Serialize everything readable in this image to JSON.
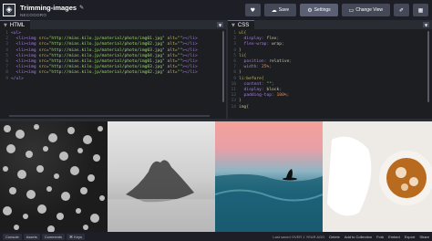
{
  "header": {
    "logo_glyph": "◈",
    "title": "Trimming-images",
    "user": "NECOGORO"
  },
  "toolbar": {
    "heart_icon": "♥",
    "save_label": "Save",
    "save_icon": "☁",
    "settings_label": "Settings",
    "settings_icon": "⚙",
    "change_view_label": "Change View",
    "change_view_icon": "▭",
    "pin_icon": "📌",
    "grid_icon": "▦"
  },
  "html_pane": {
    "label": "HTML",
    "lines": [
      {
        "n": "1",
        "code": [
          [
            "tag",
            "<ul>"
          ]
        ]
      },
      {
        "n": "2",
        "code": [
          [
            "pun",
            "  "
          ],
          [
            "tag",
            "<li>"
          ],
          [
            "tag",
            "<img "
          ],
          [
            "attr",
            "src="
          ],
          [
            "str",
            "\"http://mias.kilo.jp/material/photo/img01.jpg\""
          ],
          [
            "attr",
            " alt="
          ],
          [
            "str",
            "\"\""
          ],
          [
            "tag",
            "></li>"
          ]
        ]
      },
      {
        "n": "3",
        "code": [
          [
            "pun",
            "  "
          ],
          [
            "tag",
            "<li>"
          ],
          [
            "tag",
            "<img "
          ],
          [
            "attr",
            "src="
          ],
          [
            "str",
            "\"http://mias.kilo.jp/material/photo/img02.jpg\""
          ],
          [
            "attr",
            " alt="
          ],
          [
            "str",
            "\"\""
          ],
          [
            "tag",
            "></li>"
          ]
        ]
      },
      {
        "n": "4",
        "code": [
          [
            "pun",
            "  "
          ],
          [
            "tag",
            "<li>"
          ],
          [
            "tag",
            "<img "
          ],
          [
            "attr",
            "src="
          ],
          [
            "str",
            "\"http://mias.kilo.jp/material/photo/img03.jpg\""
          ],
          [
            "attr",
            " alt="
          ],
          [
            "str",
            "\"\""
          ],
          [
            "tag",
            "></li>"
          ]
        ]
      },
      {
        "n": "5",
        "code": [
          [
            "pun",
            "  "
          ],
          [
            "tag",
            "<li>"
          ],
          [
            "tag",
            "<img "
          ],
          [
            "attr",
            "src="
          ],
          [
            "str",
            "\"http://mias.kilo.jp/material/photo/img04.jpg\""
          ],
          [
            "attr",
            " alt="
          ],
          [
            "str",
            "\"\""
          ],
          [
            "tag",
            "></li>"
          ]
        ]
      },
      {
        "n": "6",
        "code": [
          [
            "pun",
            "  "
          ],
          [
            "tag",
            "<li>"
          ],
          [
            "tag",
            "<img "
          ],
          [
            "attr",
            "src="
          ],
          [
            "str",
            "\"http://mias.kilo.jp/material/photo/img01.jpg\""
          ],
          [
            "attr",
            " alt="
          ],
          [
            "str",
            "\"\""
          ],
          [
            "tag",
            "></li>"
          ]
        ]
      },
      {
        "n": "7",
        "code": [
          [
            "pun",
            "  "
          ],
          [
            "tag",
            "<li>"
          ],
          [
            "tag",
            "<img "
          ],
          [
            "attr",
            "src="
          ],
          [
            "str",
            "\"http://mias.kilo.jp/material/photo/img03.jpg\""
          ],
          [
            "attr",
            " alt="
          ],
          [
            "str",
            "\"\""
          ],
          [
            "tag",
            "></li>"
          ]
        ]
      },
      {
        "n": "8",
        "code": [
          [
            "pun",
            "  "
          ],
          [
            "tag",
            "<li>"
          ],
          [
            "tag",
            "<img "
          ],
          [
            "attr",
            "src="
          ],
          [
            "str",
            "\"http://mias.kilo.jp/material/photo/img02.jpg\""
          ],
          [
            "attr",
            " alt="
          ],
          [
            "str",
            "\"\""
          ],
          [
            "tag",
            "></li>"
          ]
        ]
      },
      {
        "n": "9",
        "code": [
          [
            "tag",
            "</ul>"
          ]
        ]
      }
    ]
  },
  "css_pane": {
    "label": "CSS",
    "lines": [
      {
        "n": "1",
        "code": [
          [
            "sel",
            "ul{"
          ]
        ]
      },
      {
        "n": "2",
        "code": [
          [
            "pun",
            "  "
          ],
          [
            "prop",
            "display"
          ],
          [
            "pun",
            ": "
          ],
          [
            "val",
            "flex"
          ],
          [
            "pun",
            ";"
          ]
        ]
      },
      {
        "n": "3",
        "code": [
          [
            "pun",
            "  "
          ],
          [
            "prop",
            "flex-wrap"
          ],
          [
            "pun",
            ": "
          ],
          [
            "val",
            "wrap"
          ],
          [
            "pun",
            ";"
          ]
        ]
      },
      {
        "n": "4",
        "code": [
          [
            "sel",
            "}"
          ]
        ]
      },
      {
        "n": "5",
        "code": [
          [
            "sel",
            "li{"
          ]
        ]
      },
      {
        "n": "6",
        "code": [
          [
            "pun",
            "  "
          ],
          [
            "prop",
            "position"
          ],
          [
            "pun",
            ": "
          ],
          [
            "val",
            "relative"
          ],
          [
            "pun",
            ";"
          ]
        ]
      },
      {
        "n": "7",
        "code": [
          [
            "pun",
            "  "
          ],
          [
            "prop",
            "width"
          ],
          [
            "pun",
            ": "
          ],
          [
            "num",
            "25%"
          ],
          [
            "pun",
            ";"
          ]
        ]
      },
      {
        "n": "8",
        "code": [
          [
            "sel",
            "}"
          ]
        ]
      },
      {
        "n": "9",
        "code": [
          [
            "sel",
            "li:before{"
          ]
        ]
      },
      {
        "n": "10",
        "code": [
          [
            "pun",
            "  "
          ],
          [
            "prop",
            "content"
          ],
          [
            "pun",
            ": "
          ],
          [
            "str",
            "\"\""
          ],
          [
            "pun",
            ";"
          ]
        ]
      },
      {
        "n": "11",
        "code": [
          [
            "pun",
            "  "
          ],
          [
            "prop",
            "display"
          ],
          [
            "pun",
            ": "
          ],
          [
            "val",
            "block"
          ],
          [
            "pun",
            ";"
          ]
        ]
      },
      {
        "n": "12",
        "code": [
          [
            "pun",
            "  "
          ],
          [
            "prop",
            "padding-top"
          ],
          [
            "pun",
            ": "
          ],
          [
            "num",
            "100%"
          ],
          [
            "pun",
            ";"
          ]
        ]
      },
      {
        "n": "13",
        "code": [
          [
            "sel",
            "}"
          ]
        ]
      },
      {
        "n": "14",
        "code": [
          [
            "sel",
            "img{"
          ]
        ]
      }
    ]
  },
  "footer": {
    "console": "Console",
    "assets": "Assets",
    "comments": "Comments",
    "keys": "⌘ Keys",
    "saved": "Last saved OVER 1 YEAR AGO",
    "delete": "Delete",
    "add_collection": "Add to Collection",
    "fork": "Fork",
    "embed": "Embed",
    "export": "Export",
    "share": "Share"
  }
}
